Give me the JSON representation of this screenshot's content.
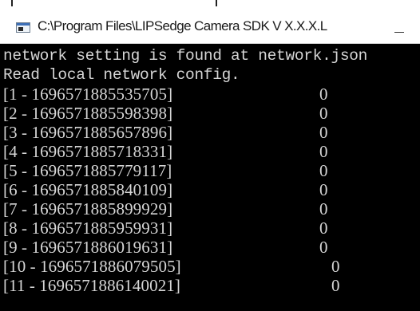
{
  "window": {
    "title": "C:\\Program Files\\LIPSedge Camera SDK V X.X.X.L"
  },
  "console": {
    "messages": [
      "network setting is found at network.json",
      "Read local network config."
    ],
    "rows": [
      {
        "label": "[1 - 1696571885535705]",
        "value": "0"
      },
      {
        "label": "[2 - 1696571885598398]",
        "value": "0"
      },
      {
        "label": "[3 - 1696571885657896]",
        "value": "0"
      },
      {
        "label": "[4 - 1696571885718331]",
        "value": "0"
      },
      {
        "label": "[5 - 1696571885779117]",
        "value": "0"
      },
      {
        "label": "[6 - 1696571885840109]",
        "value": "0"
      },
      {
        "label": "[7 - 1696571885899929]",
        "value": "0"
      },
      {
        "label": "[8 - 1696571885959931]",
        "value": "0"
      },
      {
        "label": "[9 - 1696571886019631]",
        "value": "0"
      },
      {
        "label": "[10 - 1696571886079505]",
        "value": "0"
      },
      {
        "label": "[11 - 1696571886140021]",
        "value": "0"
      }
    ]
  },
  "colors": {
    "console_background": "#000000",
    "console_text": "#d6d6d6",
    "titlebar_background": "#ffffff"
  },
  "icons": {
    "app": "console-window-icon",
    "minimize": "minimize-icon"
  }
}
